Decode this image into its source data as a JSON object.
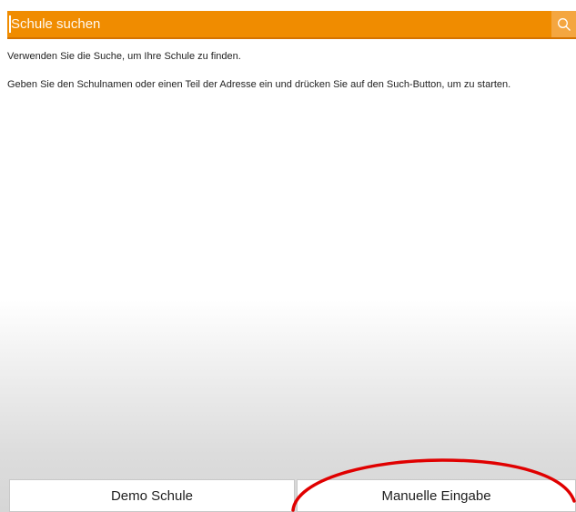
{
  "search": {
    "placeholder": "Schule suchen",
    "icon": "search-icon",
    "bar_color": "#f08c00"
  },
  "instructions": {
    "line1": "Verwenden Sie die Suche, um Ihre Schule zu finden.",
    "line2": "Geben Sie den Schulnamen oder einen Teil der Adresse ein und drücken Sie auf den Such-Button, um zu starten."
  },
  "buttons": {
    "demo": "Demo Schule",
    "manual": "Manuelle Eingabe"
  },
  "annotation": {
    "highlight_color": "#e00000",
    "target": "Manuelle Eingabe"
  }
}
